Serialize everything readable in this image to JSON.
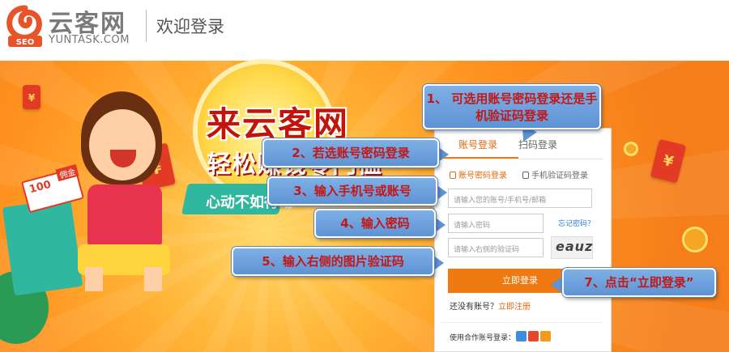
{
  "header": {
    "logo_cn": "云客网",
    "logo_en": "YUNTASK.COM",
    "logo_badge": "SEO",
    "welcome": "欢迎登录"
  },
  "banner": {
    "headline1": "来云客网",
    "headline2": "轻松赚钱零门槛",
    "ribbon": "心动不如行动",
    "card_amount": "100",
    "card_tag": "佣金",
    "envelope_symbol": "¥"
  },
  "login": {
    "tabs": [
      "账号登录",
      "扫码登录"
    ],
    "modes": [
      "账号密码登录",
      "手机验证码登录"
    ],
    "account_placeholder": "请输入您的账号/手机号/邮箱",
    "password_placeholder": "请输入密码",
    "code_placeholder": "请输入右侧的验证码",
    "forgot": "忘记密码？",
    "captcha": "eauz",
    "login_button": "立即登录",
    "no_account": "还没有账号？",
    "register": "立即注册",
    "coop": "使用合作账号登录："
  },
  "callouts": {
    "c1": "1、 可选用账号密码登录还是手机验证码登录",
    "c2": "2、若选账号密码登录",
    "c3": "3、输入手机号或账号",
    "c4": "4、输入密码",
    "c5": "5、输入右侧的图片验证码",
    "c7": "7、点击“立即登录”"
  },
  "colors": {
    "accent": "#f07a12",
    "callout_bg": "#5e93d4",
    "callout_text": "#c21818"
  },
  "icons": [
    "user-icon",
    "phone-icon",
    "qq-icon",
    "weibo-icon",
    "renren-icon"
  ]
}
